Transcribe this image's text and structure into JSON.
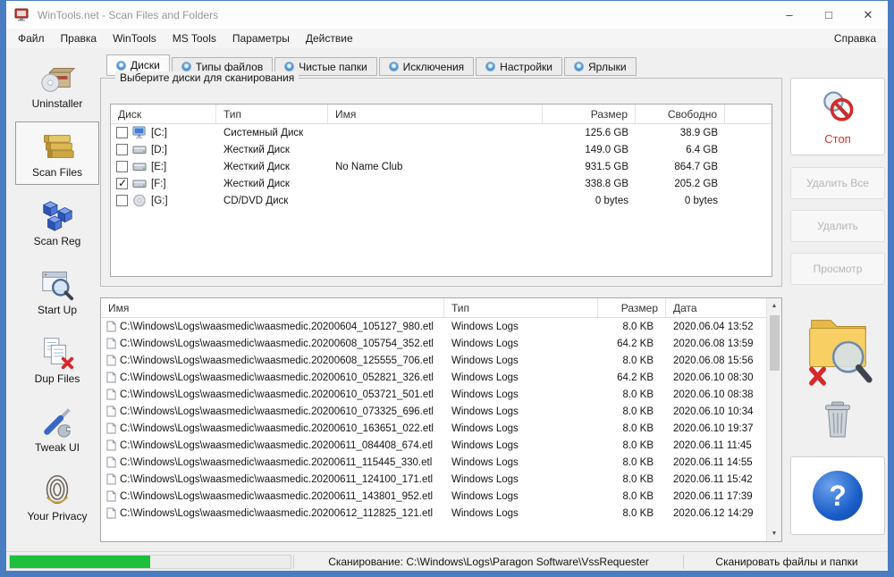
{
  "colors": {
    "window_border_blue": "#4a7cc2",
    "progress_green": "#1dbf3d",
    "help_blue": "#1a5dc8",
    "stop_red": "#d03232"
  },
  "window": {
    "title": "WinTools.net - Scan Files and Folders",
    "controls": {
      "minimize": "–",
      "maximize": "□",
      "close": "✕"
    }
  },
  "menubar": {
    "items": [
      "Файл",
      "Правка",
      "WinTools",
      "MS Tools",
      "Параметры",
      "Действие"
    ],
    "help": "Справка"
  },
  "sidebar": {
    "items": [
      {
        "label": "Uninstaller",
        "icon": "uninstaller",
        "selected": false
      },
      {
        "label": "Scan Files",
        "icon": "scan-files",
        "selected": true
      },
      {
        "label": "Scan Reg",
        "icon": "scan-reg",
        "selected": false
      },
      {
        "label": "Start Up",
        "icon": "start-up",
        "selected": false
      },
      {
        "label": "Dup Files",
        "icon": "dup-files",
        "selected": false
      },
      {
        "label": "Tweak UI",
        "icon": "tweak-ui",
        "selected": false
      },
      {
        "label": "Your Privacy",
        "icon": "your-privacy",
        "selected": false
      }
    ]
  },
  "tabs": [
    {
      "label": "Диски",
      "selected": true
    },
    {
      "label": "Типы файлов",
      "selected": false
    },
    {
      "label": "Чистые папки",
      "selected": false
    },
    {
      "label": "Исключения",
      "selected": false
    },
    {
      "label": "Настройки",
      "selected": false
    },
    {
      "label": "Ярлыки",
      "selected": false
    }
  ],
  "disks": {
    "group_title": "Выберите диски для сканирования",
    "columns": [
      "Диск",
      "Тип",
      "Имя",
      "Размер",
      "Свободно"
    ],
    "rows": [
      {
        "checked": false,
        "icon": "system-drive",
        "drive": "[C:]",
        "type": "Системный Диск",
        "name": "",
        "size": "125.6 GB",
        "free": "38.9 GB"
      },
      {
        "checked": false,
        "icon": "hdd",
        "drive": "[D:]",
        "type": "Жесткий Диск",
        "name": "",
        "size": "149.0 GB",
        "free": "6.4 GB"
      },
      {
        "checked": false,
        "icon": "hdd",
        "drive": "[E:]",
        "type": "Жесткий Диск",
        "name": "No Name Club",
        "size": "931.5 GB",
        "free": "864.7 GB"
      },
      {
        "checked": true,
        "icon": "hdd",
        "drive": "[F:]",
        "type": "Жесткий Диск",
        "name": "",
        "size": "338.8 GB",
        "free": "205.2 GB"
      },
      {
        "checked": false,
        "icon": "cd-drive",
        "drive": "[G:]",
        "type": "CD/DVD Диск",
        "name": "",
        "size": "0 bytes",
        "free": "0 bytes"
      }
    ]
  },
  "files": {
    "columns": [
      "Имя",
      "Тип",
      "Размер",
      "Дата"
    ],
    "rows": [
      {
        "name": "C:\\Windows\\Logs\\waasmedic\\waasmedic.20200604_105127_980.etl",
        "type": "Windows Logs",
        "size": "8.0 KB",
        "date": "2020.06.04 13:52"
      },
      {
        "name": "C:\\Windows\\Logs\\waasmedic\\waasmedic.20200608_105754_352.etl",
        "type": "Windows Logs",
        "size": "64.2 KB",
        "date": "2020.06.08 13:59"
      },
      {
        "name": "C:\\Windows\\Logs\\waasmedic\\waasmedic.20200608_125555_706.etl",
        "type": "Windows Logs",
        "size": "8.0 KB",
        "date": "2020.06.08 15:56"
      },
      {
        "name": "C:\\Windows\\Logs\\waasmedic\\waasmedic.20200610_052821_326.etl",
        "type": "Windows Logs",
        "size": "64.2 KB",
        "date": "2020.06.10 08:30"
      },
      {
        "name": "C:\\Windows\\Logs\\waasmedic\\waasmedic.20200610_053721_501.etl",
        "type": "Windows Logs",
        "size": "8.0 KB",
        "date": "2020.06.10 08:38"
      },
      {
        "name": "C:\\Windows\\Logs\\waasmedic\\waasmedic.20200610_073325_696.etl",
        "type": "Windows Logs",
        "size": "8.0 KB",
        "date": "2020.06.10 10:34"
      },
      {
        "name": "C:\\Windows\\Logs\\waasmedic\\waasmedic.20200610_163651_022.etl",
        "type": "Windows Logs",
        "size": "8.0 KB",
        "date": "2020.06.10 19:37"
      },
      {
        "name": "C:\\Windows\\Logs\\waasmedic\\waasmedic.20200611_084408_674.etl",
        "type": "Windows Logs",
        "size": "8.0 KB",
        "date": "2020.06.11 11:45"
      },
      {
        "name": "C:\\Windows\\Logs\\waasmedic\\waasmedic.20200611_115445_330.etl",
        "type": "Windows Logs",
        "size": "8.0 KB",
        "date": "2020.06.11 14:55"
      },
      {
        "name": "C:\\Windows\\Logs\\waasmedic\\waasmedic.20200611_124100_171.etl",
        "type": "Windows Logs",
        "size": "8.0 KB",
        "date": "2020.06.11 15:42"
      },
      {
        "name": "C:\\Windows\\Logs\\waasmedic\\waasmedic.20200611_143801_952.etl",
        "type": "Windows Logs",
        "size": "8.0 KB",
        "date": "2020.06.11 17:39"
      },
      {
        "name": "C:\\Windows\\Logs\\waasmedic\\waasmedic.20200612_112825_121.etl",
        "type": "Windows Logs",
        "size": "8.0 KB",
        "date": "2020.06.12 14:29"
      }
    ]
  },
  "right_panel": {
    "stop_label": "Стоп",
    "delete_all_label": "Удалить Все",
    "delete_label": "Удалить",
    "preview_label": "Просмотр",
    "help_glyph": "?"
  },
  "statusbar": {
    "progress_percent": 50,
    "scanning_text": "Сканирование: C:\\Windows\\Logs\\Paragon Software\\VssRequester",
    "mode_text": "Сканировать файлы и папки"
  }
}
